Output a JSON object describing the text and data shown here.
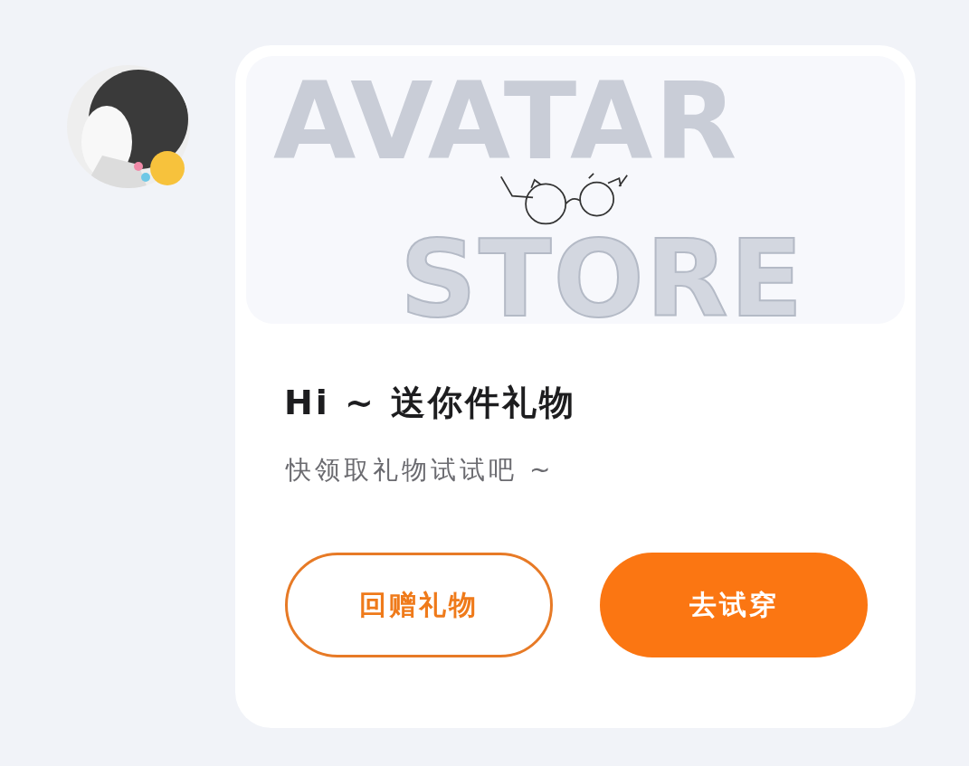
{
  "card": {
    "banner": {
      "words": [
        "AVATAR",
        "STORE"
      ]
    },
    "title": "Hi ~ 送你件礼物",
    "subtitle": "快领取礼物试试吧 ~",
    "buttons": [
      {
        "label": "回赠礼物",
        "kind": "outline"
      },
      {
        "label": "去试穿",
        "kind": "filled"
      }
    ]
  }
}
